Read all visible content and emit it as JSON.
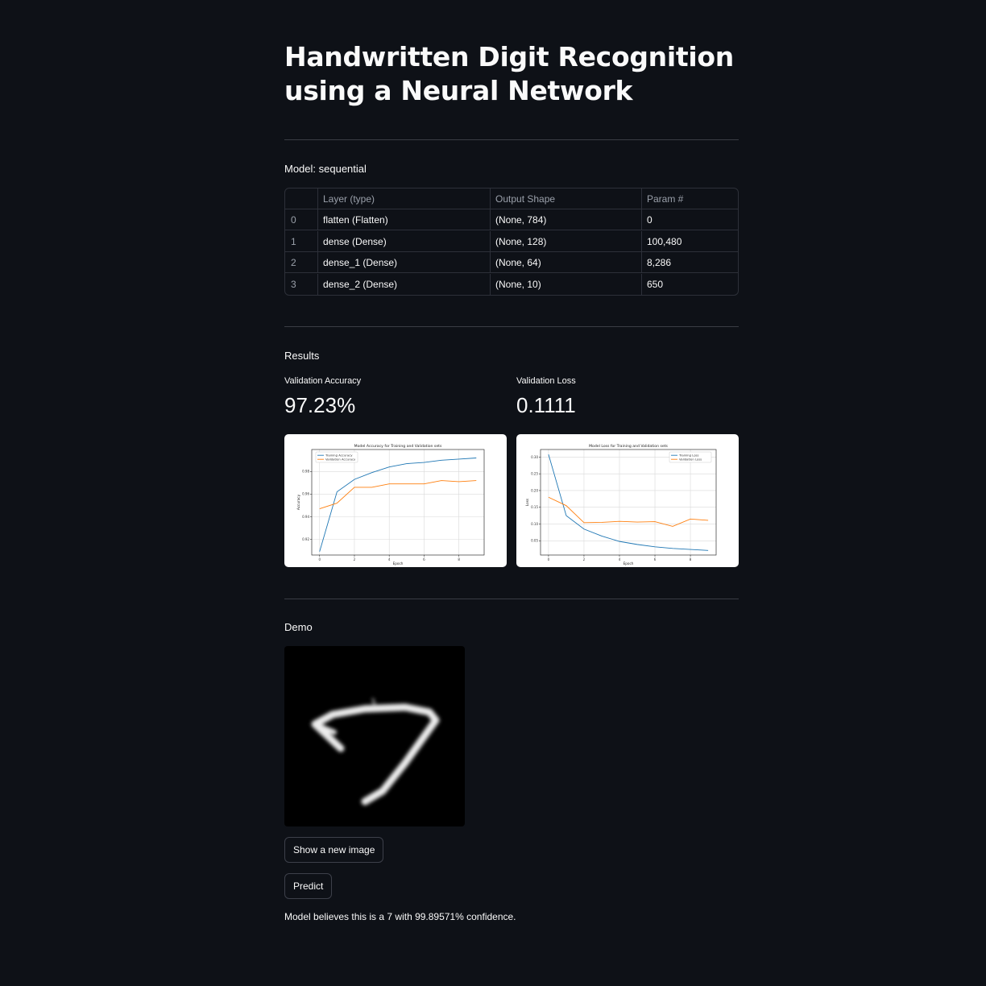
{
  "page": {
    "title": "Handwritten Digit Recognition using a Neural Network"
  },
  "model": {
    "label": "Model: sequential",
    "columns": [
      "",
      "Layer (type)",
      "Output Shape",
      "Param #"
    ],
    "rows": [
      [
        "0",
        "flatten (Flatten)",
        "(None, 784)",
        "0"
      ],
      [
        "1",
        "dense (Dense)",
        "(None, 128)",
        "100,480"
      ],
      [
        "2",
        "dense_1 (Dense)",
        "(None, 64)",
        "8,286"
      ],
      [
        "3",
        "dense_2 (Dense)",
        "(None, 10)",
        "650"
      ]
    ]
  },
  "results": {
    "label": "Results",
    "accuracy_label": "Validation Accuracy",
    "accuracy_value": "97.23%",
    "loss_label": "Validation Loss",
    "loss_value": "0.1111"
  },
  "chart_data": [
    {
      "type": "line",
      "title": "Model Accuracy for Training and Validation sets",
      "xlabel": "Epoch",
      "ylabel": "Accuracy",
      "x": [
        0,
        1,
        2,
        3,
        4,
        5,
        6,
        7,
        8,
        9
      ],
      "xticks": [
        0,
        2,
        4,
        6,
        8
      ],
      "yticks": [
        0.92,
        0.94,
        0.96,
        0.98
      ],
      "xlim": [
        -0.45,
        9.45
      ],
      "ylim": [
        0.906,
        0.9995
      ],
      "grid": true,
      "legend": "top-left",
      "series": [
        {
          "name": "Training Accuracy",
          "color": "#1f77b4",
          "values": [
            0.909,
            0.962,
            0.973,
            0.979,
            0.984,
            0.987,
            0.988,
            0.99,
            0.991,
            0.992
          ]
        },
        {
          "name": "Validation Accuracy",
          "color": "#ff7f0e",
          "values": [
            0.947,
            0.952,
            0.966,
            0.966,
            0.969,
            0.969,
            0.969,
            0.972,
            0.971,
            0.972
          ]
        }
      ]
    },
    {
      "type": "line",
      "title": "Model Loss for Training and Validation sets",
      "xlabel": "Epoch",
      "ylabel": "Loss",
      "x": [
        0,
        1,
        2,
        3,
        4,
        5,
        6,
        7,
        8,
        9
      ],
      "xticks": [
        0,
        2,
        4,
        6,
        8
      ],
      "yticks": [
        0.05,
        0.1,
        0.15,
        0.2,
        0.25,
        0.3
      ],
      "xlim": [
        -0.45,
        9.45
      ],
      "ylim": [
        0.0074,
        0.3226
      ],
      "grid": true,
      "legend": "top-right",
      "series": [
        {
          "name": "Training Loss",
          "color": "#1f77b4",
          "values": [
            0.308,
            0.125,
            0.085,
            0.064,
            0.048,
            0.039,
            0.032,
            0.027,
            0.024,
            0.021
          ]
        },
        {
          "name": "Validation Loss",
          "color": "#ff7f0e",
          "values": [
            0.18,
            0.155,
            0.104,
            0.105,
            0.108,
            0.106,
            0.107,
            0.093,
            0.115,
            0.111
          ]
        }
      ]
    }
  ],
  "demo": {
    "label": "Demo",
    "new_image_button": "Show a new image",
    "predict_button": "Predict",
    "result_text": "Model believes this is a 7 with 99.89571% confidence."
  }
}
